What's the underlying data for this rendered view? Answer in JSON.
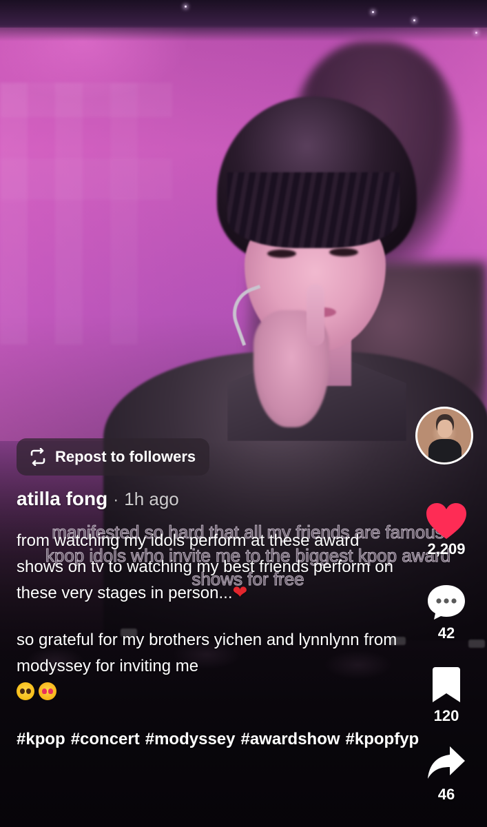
{
  "video": {
    "overlay_caption": "manifested so hard that all my friends are famous kpop idols who invite me to the biggest kpop award shows for free"
  },
  "repost": {
    "label": "Repost to followers",
    "icon": "repost-icon"
  },
  "post": {
    "author": "atilla fong",
    "separator": "·",
    "time_ago": "1h ago",
    "caption_line_1": "from watching my idols perform at these award shows on tv to watching my best friends perform on these very stages in person...",
    "caption_emoji_1": "❤️",
    "caption_line_2": "so grateful for my brothers yichen and lynnlynn from modyssey for inviting me",
    "hashtags": [
      "#kpop",
      "#concert",
      "#modyssey",
      "#awardshow",
      "#kpopfyp"
    ]
  },
  "actions": {
    "like_count": "2,209",
    "comment_count": "42",
    "bookmark_count": "120",
    "share_count": "46"
  },
  "colors": {
    "like": "#fe2c55",
    "text": "#ffffff",
    "chip_bg": "rgba(45,35,45,0.72)"
  }
}
